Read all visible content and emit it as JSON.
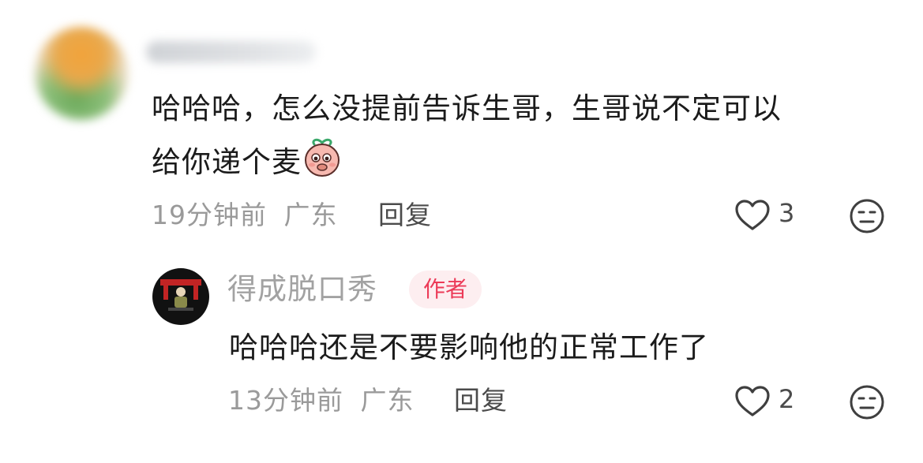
{
  "comments": [
    {
      "text_line1": "哈哈哈，怎么没提前告诉生哥，生哥说不定可以",
      "text_line2": "给你递个麦",
      "emoji": "peach-emoji",
      "time": "19分钟前",
      "location": "广东",
      "reply_label": "回复",
      "likes": "3"
    }
  ],
  "reply": {
    "author": "得成脱口秀",
    "author_tag": "作者",
    "text": "哈哈哈还是不要影响他的正常工作了",
    "time": "13分钟前",
    "location": "广东",
    "reply_label": "回复",
    "likes": "2"
  },
  "icons": {
    "like": "heart-outline-icon",
    "dislike": "meh-face-icon"
  },
  "colors": {
    "tag_bg": "#fdeef0",
    "tag_text": "#ec3b58",
    "meta_text": "#9a9a9a"
  }
}
